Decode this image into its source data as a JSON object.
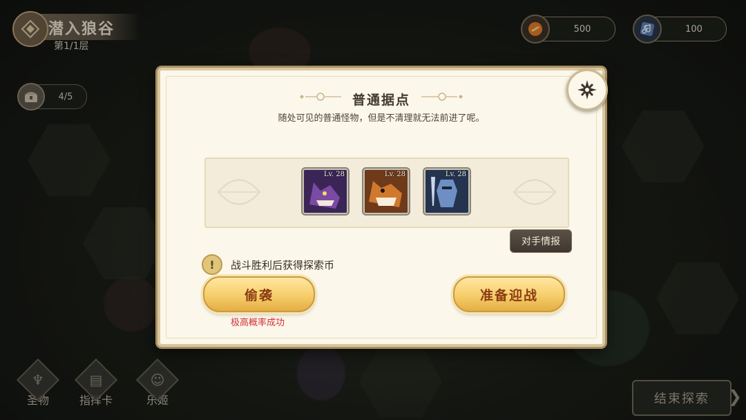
{
  "hud": {
    "stage_title": "潜入狼谷",
    "floor": "第1/1层",
    "currency_orange": "500",
    "currency_blue": "100",
    "chest_count": "4/5",
    "end_button": "结束探索"
  },
  "nav": [
    {
      "label": "圣物",
      "icon": "chalice-icon"
    },
    {
      "label": "指挥卡",
      "icon": "card-icon"
    },
    {
      "label": "乐姬",
      "icon": "character-icon"
    }
  ],
  "dialog": {
    "title": "普通据点",
    "description": "随处可见的普通怪物，但是不清理就无法前进了呢。",
    "enemies": [
      {
        "level": "Lv. 28",
        "name": "purple-wolf",
        "color": "#5b3a7d"
      },
      {
        "level": "Lv. 28",
        "name": "orange-wolf",
        "color": "#b5612b"
      },
      {
        "level": "Lv. 28",
        "name": "armored-knight",
        "color": "#3e5a8c"
      }
    ],
    "intel_button": "对手情报",
    "hint": "战斗胜利后获得探索币",
    "sneak_button": "偷袭",
    "sneak_note": "极高概率成功",
    "battle_button": "准备迎战"
  },
  "colors": {
    "accent_gold": "#f6cd6a",
    "sneak_note_red": "#d4313a",
    "panel_bg": "#fbf7ea"
  }
}
